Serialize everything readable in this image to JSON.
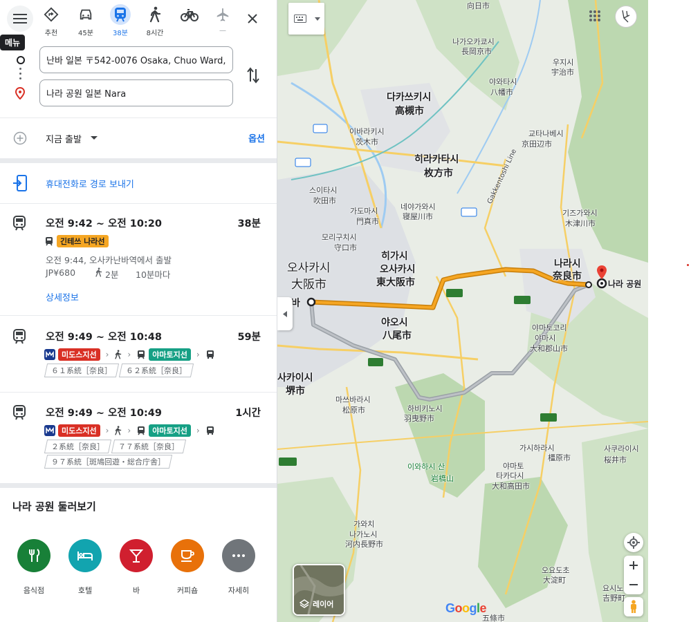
{
  "menu": {
    "tooltip": "메뉴"
  },
  "modes": [
    {
      "label": "추천",
      "icon": "best-route-icon"
    },
    {
      "label": "45분",
      "icon": "car-icon"
    },
    {
      "label": "38분",
      "icon": "transit-icon"
    },
    {
      "label": "8시간",
      "icon": "walk-icon"
    },
    {
      "label": "",
      "icon": "bicycle-icon"
    },
    {
      "label": "—",
      "icon": "flight-icon"
    }
  ],
  "origin": {
    "value": "난바 일본 〒542-0076 Osaka, Chuo Ward,"
  },
  "destination": {
    "value": "나라 공원 일본 Nara"
  },
  "depart": {
    "label": "지금 출발",
    "options_label": "옵션"
  },
  "send_to_phone": "휴대전화로 경로 보내기",
  "routes": [
    {
      "time": "오전 9:42 ~ 오전 10:20",
      "duration": "38분",
      "line1": "긴테쓰 나라선",
      "depart_info": "오전 9:44, 오사카난바역에서 출발",
      "fare": "JP¥680",
      "walk": "2분",
      "frequency": "10분마다",
      "details_label": "상세정보"
    },
    {
      "time": "오전 9:49 ~ 오전 10:48",
      "duration": "59분",
      "line1": "미도스지선",
      "line2": "야마토지선",
      "buses": [
        "６１系統［奈良］",
        "６２系統［奈良］"
      ]
    },
    {
      "time": "오전 9:49 ~ 오전 10:49",
      "duration": "1시간",
      "line1": "미도스지선",
      "line2": "야마토지선",
      "buses": [
        "２系統［奈良］",
        "７７系統［奈良］",
        "９７系統［斑鳩回遊・総合庁舎］"
      ]
    }
  ],
  "explore": {
    "title": "나라 공원 둘러보기",
    "categories": [
      {
        "label": "음식점",
        "color": "#188038",
        "icon": "restaurant-icon"
      },
      {
        "label": "호텔",
        "color": "#12a4af",
        "icon": "hotel-icon"
      },
      {
        "label": "바",
        "color": "#d01f2f",
        "icon": "bar-icon"
      },
      {
        "label": "커피숍",
        "color": "#e8710a",
        "icon": "coffee-icon"
      },
      {
        "label": "자세히",
        "color": "#70757a",
        "icon": "more-icon"
      }
    ]
  },
  "map": {
    "layer_label": "레이어",
    "logo": "Google",
    "destination_label": "나라 공원",
    "labels": {
      "l1": "向日市",
      "l2": "나가오카쿄시",
      "l3": "長岡京市",
      "l4": "우지시",
      "l5": "宇治市",
      "l6": "야와타시",
      "l7": "八幡市",
      "l8": "다카쓰키시",
      "l9": "高槻市",
      "l10": "이바라키시",
      "l11": "茨木市",
      "l12": "히라카타시",
      "l13": "枚方市",
      "l14": "교타나베시",
      "l15": "京田辺市",
      "l16": "스이타시",
      "l17": "吹田市",
      "l18": "가도마시",
      "l19": "門真市",
      "l20": "네야가와시",
      "l21": "寝屋川市",
      "l22": "기즈가와시",
      "l23": "木津川市",
      "l24": "모리구치시",
      "l25": "守口市",
      "l26": "오사카시",
      "l27": "大阪市",
      "l28": "히가시",
      "l29": "오사카시",
      "l30": "東大阪市",
      "l31": "나라시",
      "l32": "奈良市",
      "l33": "야오시",
      "l34": "八尾市",
      "l35": "야마토코리",
      "l36": "야마시",
      "l37": "大和郡山市",
      "l38": "사카이시",
      "l39": "堺市",
      "l40": "마쓰바라시",
      "l41": "松原市",
      "l42": "하비키노시",
      "l43": "羽曳野市",
      "l44": "가시하라시",
      "l45": "橿原市",
      "l46": "사쿠라이시",
      "l47": "桜井市",
      "l48": "이와하시 산",
      "l49": "岩橋山",
      "l50": "야마토",
      "l51": "타카다시",
      "l52": "大和高田市",
      "l53": "가와치",
      "l54": "나가노시",
      "l55": "河内長野市",
      "l56": "오요도초",
      "l57": "大淀町",
      "l58": "요시노초",
      "l59": "吉野町",
      "l60": "五條市",
      "l61": "Gakkentoshi Line",
      "l62": "바"
    }
  }
}
